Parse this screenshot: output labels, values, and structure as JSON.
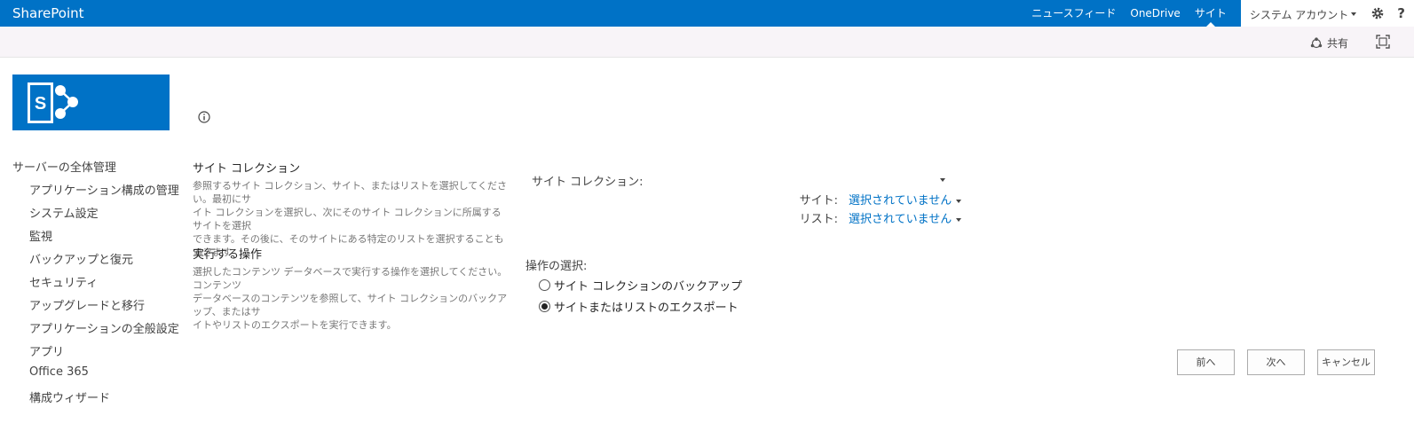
{
  "app": {
    "brand": "SharePoint"
  },
  "suitebar": {
    "links": [
      {
        "label": "ニュースフィード"
      },
      {
        "label": "OneDrive"
      },
      {
        "label": "サイト"
      }
    ],
    "account": "システム アカウント",
    "help_glyph": "?"
  },
  "ribbon": {
    "share_label": "共有"
  },
  "nav": {
    "header": "サーバーの全体管理",
    "items": [
      {
        "label": "アプリケーション構成の管理"
      },
      {
        "label": "システム設定"
      },
      {
        "label": "監視"
      },
      {
        "label": "バックアップと復元"
      },
      {
        "label": "セキュリティ"
      },
      {
        "label": "アップグレードと移行"
      },
      {
        "label": "アプリケーションの全般設定"
      },
      {
        "label": "アプリ"
      },
      {
        "label": "Office 365"
      },
      {
        "label": "構成ウィザード"
      }
    ]
  },
  "main": {
    "site_collection_section": {
      "title": "サイト コレクション",
      "desc_lines": [
        "参照するサイト コレクション、サイト、またはリストを選択してください。最初にサ",
        "イト コレクションを選択し、次にそのサイト コレクションに所属するサイトを選択",
        "できます。その後に、そのサイトにある特定のリストを選択することもできます"
      ]
    },
    "operation_section": {
      "title": "実行する操作",
      "desc_lines": [
        "選択したコンテンツ データベースで実行する操作を選択してください。コンテンツ",
        "データベースのコンテンツを参照して、サイト コレクションのバックアップ、またはサ",
        "イトやリストのエクスポートを実行できます。"
      ]
    },
    "fields": {
      "site_collection_label": "サイト コレクション:",
      "site_label": "サイト:",
      "site_value": "選択されていません",
      "list_label": "リスト:",
      "list_value": "選択されていません"
    },
    "operation": {
      "label": "操作の選択:",
      "options": [
        {
          "label": "サイト コレクションのバックアップ",
          "selected": false
        },
        {
          "label": "サイトまたはリストのエクスポート",
          "selected": true
        }
      ]
    },
    "buttons": {
      "prev": "前へ",
      "next": "次へ",
      "cancel": "キャンセル"
    }
  },
  "colors": {
    "brand_blue": "#0072c6",
    "link_blue": "#0072c6"
  }
}
